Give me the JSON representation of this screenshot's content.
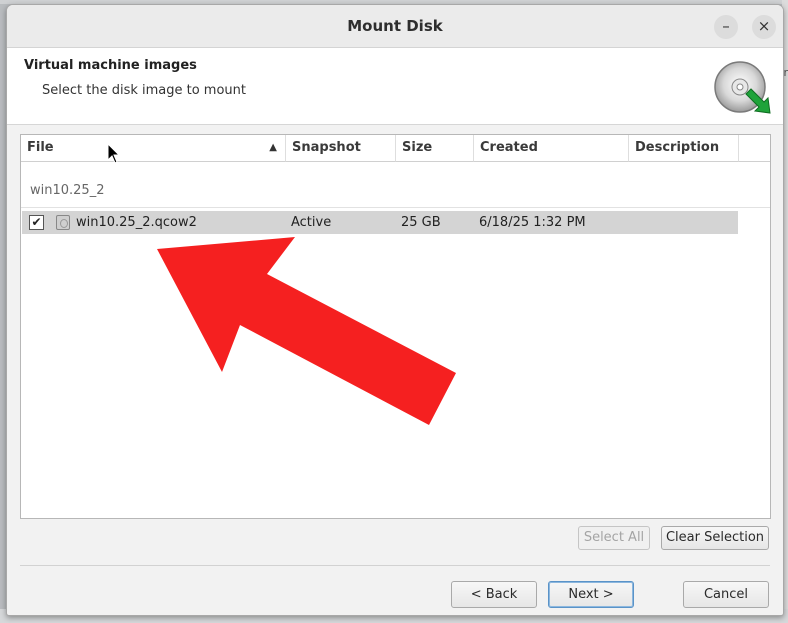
{
  "window": {
    "title": "Mount Disk"
  },
  "header": {
    "title": "Virtual machine images",
    "subtitle": "Select the disk image to mount"
  },
  "table": {
    "columns": [
      {
        "label": "File"
      },
      {
        "label": "Snapshot"
      },
      {
        "label": "Size"
      },
      {
        "label": "Created"
      },
      {
        "label": "Description"
      }
    ],
    "group": "win10.25_2",
    "rows": [
      {
        "checked": true,
        "file": "win10.25_2.qcow2",
        "snapshot": "Active",
        "size": "25 GB",
        "created": "6/18/25 1:32 PM",
        "description": ""
      }
    ]
  },
  "selection": {
    "select_all": "Select All",
    "clear_selection": "Clear Selection"
  },
  "footer": {
    "back": "< Back",
    "next": "Next >",
    "cancel": "Cancel"
  },
  "background": {
    "edge_text": "r"
  },
  "colors": {
    "annotation_arrow": "#f52020",
    "primary_focus": "#5a93c8"
  }
}
